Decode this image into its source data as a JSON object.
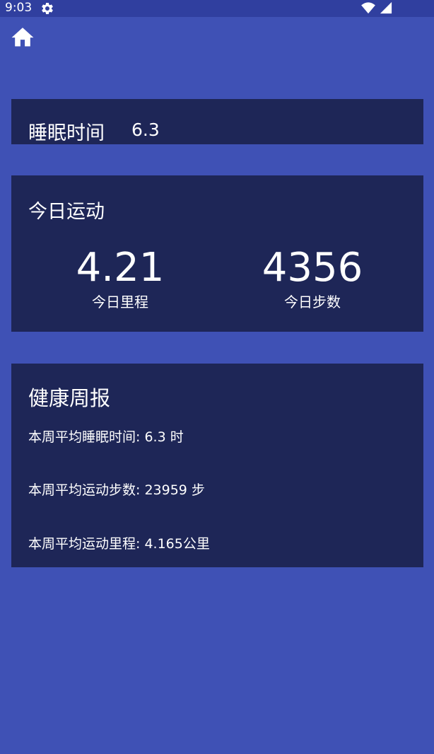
{
  "status_bar": {
    "time": "9:03"
  },
  "nav": {
    "home_icon": "home-icon"
  },
  "sleep_card": {
    "label": "睡眠时间",
    "value": "6.3"
  },
  "activity_card": {
    "title": "今日运动",
    "distance_value": "4.21",
    "distance_label": "今日里程",
    "steps_value": "4356",
    "steps_label": "今日步数"
  },
  "report_card": {
    "title": "健康周报",
    "lines": [
      "本周平均睡眠时间: 6.3 时",
      "本周平均运动步数: 23959 步",
      "本周平均运动里程: 4.165公里"
    ]
  },
  "colors": {
    "background": "#3F51B5",
    "status_bar": "#303F9F",
    "card": "#1E2657",
    "text": "#FFFFFF"
  }
}
